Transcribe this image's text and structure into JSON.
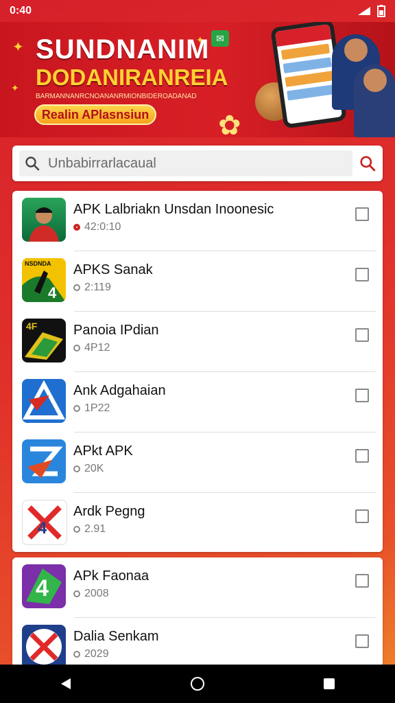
{
  "status_bar": {
    "time": "0:40",
    "icons": [
      "signal-icon",
      "battery-icon"
    ]
  },
  "banner": {
    "title": "SUNDNANIM",
    "subtitle": "DODANIRANREIA",
    "caption": "BARMANNANRCNOANANRMIONBIDEROADANAD",
    "cta": "Realin APlasnsiun"
  },
  "search": {
    "placeholder": "Unbabirrarlacaual"
  },
  "apps_primary": [
    {
      "title": "APK Lalbriakn Unsdan Inoonesic",
      "meta": "42:0:10",
      "icon": "player-avatar-icon",
      "colors": [
        "#1f8a4c",
        "#0b5d33"
      ]
    },
    {
      "title": "APKS Sanak",
      "meta": "2:119",
      "icon": "cricket-player-icon",
      "colors": [
        "#f2c200",
        "#1a7a2a"
      ]
    },
    {
      "title": "Panoia IPdian",
      "meta": "4P12",
      "icon": "flag-logo-icon",
      "colors": [
        "#111111",
        "#e0c21a"
      ]
    },
    {
      "title": "Ank Adgahaian",
      "meta": "1P22",
      "icon": "triangle-logo-icon",
      "colors": [
        "#1f6fd0",
        "#d62a22"
      ]
    },
    {
      "title": "APkt APK",
      "meta": "20K",
      "icon": "z-logo-icon",
      "colors": [
        "#2a86dc",
        "#e04a22"
      ]
    },
    {
      "title": "Ardk Pegng",
      "meta": "2.91",
      "icon": "cross-logo-icon",
      "colors": [
        "#ffffff",
        "#e02a2a"
      ]
    }
  ],
  "apps_secondary": [
    {
      "title": "APk Faonaa",
      "meta": "2008",
      "icon": "four-logo-icon",
      "colors": [
        "#7b2fa8",
        "#33b54a"
      ]
    },
    {
      "title": "Dalia Senkam",
      "meta": "2029",
      "icon": "x-badge-icon",
      "colors": [
        "#1f3f8a",
        "#e02a2a"
      ]
    }
  ],
  "nav": {
    "icons": [
      "back-icon",
      "home-icon",
      "recents-icon"
    ]
  }
}
